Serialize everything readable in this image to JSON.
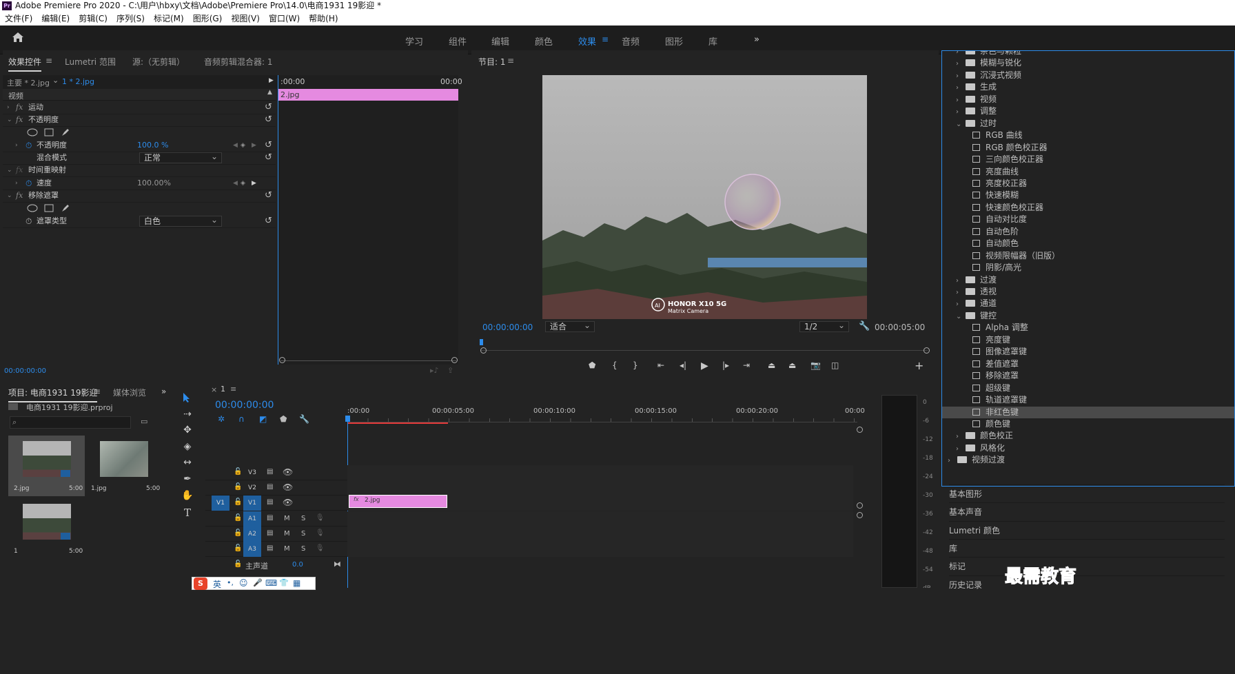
{
  "app": {
    "window_title": "Adobe Premiere Pro 2020 - C:\\用户\\hbxy\\文档\\Adobe\\Premiere Pro\\14.0\\电商1931  19影迎 *",
    "logo": "Pr"
  },
  "menu": [
    "文件(F)",
    "编辑(E)",
    "剪辑(C)",
    "序列(S)",
    "标记(M)",
    "图形(G)",
    "视图(V)",
    "窗口(W)",
    "帮助(H)"
  ],
  "workspaces": {
    "tabs": [
      "学习",
      "组件",
      "编辑",
      "颜色",
      "效果",
      "音频",
      "图形",
      "库"
    ],
    "active": "效果",
    "more": "»",
    "menu_glyph": "≡"
  },
  "effect_controls": {
    "tabs": [
      "效果控件",
      "Lumetri 范围",
      "源:（无剪辑）",
      "音频剪辑混合器: 1"
    ],
    "menu_glyph": "≡",
    "master_label": "主要 * 2.jpg",
    "clip_label": "1 * 2.jpg",
    "time_start": ":00:00",
    "time_end": "00:00",
    "clip_bar_label": "2.jpg",
    "section_video": "视频",
    "rows": [
      {
        "name": "运动",
        "kind": "effect"
      },
      {
        "name": "不透明度",
        "kind": "effect"
      },
      {
        "name": "不透明度",
        "kind": "param",
        "value": "100.0 %"
      },
      {
        "name": "混合模式",
        "kind": "param",
        "value": "正常"
      },
      {
        "name": "时间重映射",
        "kind": "effect"
      },
      {
        "name": "速度",
        "kind": "param",
        "value": "100.00%"
      },
      {
        "name": "移除遮罩",
        "kind": "effect"
      },
      {
        "name": "遮罩类型",
        "kind": "param",
        "value": "白色"
      }
    ],
    "fx_label": "fx",
    "timecode": "00:00:00:00"
  },
  "program_monitor": {
    "title": "节目: 1",
    "menu_glyph": "≡",
    "timecode": "00:00:00:00",
    "zoom": "适合",
    "resolution": "1/2",
    "duration": "00:00:05:00",
    "watermark_brand": "HONOR X10 5G",
    "watermark_sub": "Matrix Camera",
    "watermark_logo": "AI",
    "controls": [
      "marker",
      "in",
      "out",
      "go-to-in",
      "step-back",
      "play",
      "step-forward",
      "go-to-out",
      "lift",
      "extract",
      "export-frame",
      "comparison"
    ],
    "add_glyph": "+"
  },
  "project": {
    "tabs": [
      "项目: 电商1931  19影迎",
      "媒体浏览"
    ],
    "menu_glyph": "≡",
    "more": "»",
    "file": "电商1931  19影迎.prproj",
    "search_placeholder": "",
    "items": [
      {
        "name": "2.jpg",
        "duration": "5:00"
      },
      {
        "name": "1.jpg",
        "duration": "5:00"
      },
      {
        "name": "1",
        "duration": "5:00"
      }
    ]
  },
  "timeline": {
    "tab": "1",
    "close": "×",
    "menu_glyph": "≡",
    "timecode": "00:00:00:00",
    "ruler": [
      ":00:00",
      "00:00:05:00",
      "00:00:10:00",
      "00:00:15:00",
      "00:00:20:00",
      "00:00"
    ],
    "video_tracks": [
      "V3",
      "V2",
      "V1"
    ],
    "source_patch": "V1",
    "audio_tracks": [
      "A1",
      "A2",
      "A3"
    ],
    "mute": "M",
    "solo": "S",
    "master": "主声道",
    "master_value": "0.0",
    "clip_label": "2.jpg",
    "clip_fx": "fx"
  },
  "effects_tree": [
    {
      "label": "杂色与颗粒",
      "type": "folder",
      "level": 1,
      "open": false
    },
    {
      "label": "模糊与锐化",
      "type": "folder",
      "level": 1,
      "open": false
    },
    {
      "label": "沉浸式视频",
      "type": "folder",
      "level": 1,
      "open": false
    },
    {
      "label": "生成",
      "type": "folder",
      "level": 1,
      "open": false
    },
    {
      "label": "视频",
      "type": "folder",
      "level": 1,
      "open": false
    },
    {
      "label": "调整",
      "type": "folder",
      "level": 1,
      "open": false
    },
    {
      "label": "过时",
      "type": "folder",
      "level": 1,
      "open": true
    },
    {
      "label": "RGB 曲线",
      "type": "preset",
      "level": 2
    },
    {
      "label": "RGB 颜色校正器",
      "type": "preset",
      "level": 2
    },
    {
      "label": "三向颜色校正器",
      "type": "preset",
      "level": 2
    },
    {
      "label": "亮度曲线",
      "type": "preset",
      "level": 2
    },
    {
      "label": "亮度校正器",
      "type": "preset",
      "level": 2
    },
    {
      "label": "快速模糊",
      "type": "preset",
      "level": 2
    },
    {
      "label": "快速颜色校正器",
      "type": "preset",
      "level": 2
    },
    {
      "label": "自动对比度",
      "type": "preset",
      "level": 2
    },
    {
      "label": "自动色阶",
      "type": "preset",
      "level": 2
    },
    {
      "label": "自动颜色",
      "type": "preset",
      "level": 2
    },
    {
      "label": "视频限幅器（旧版）",
      "type": "preset",
      "level": 2
    },
    {
      "label": "阴影/高光",
      "type": "preset",
      "level": 2
    },
    {
      "label": "过渡",
      "type": "folder",
      "level": 1,
      "open": false
    },
    {
      "label": "透视",
      "type": "folder",
      "level": 1,
      "open": false
    },
    {
      "label": "通道",
      "type": "folder",
      "level": 1,
      "open": false
    },
    {
      "label": "键控",
      "type": "folder",
      "level": 1,
      "open": true
    },
    {
      "label": "Alpha 调整",
      "type": "preset",
      "level": 2
    },
    {
      "label": "亮度键",
      "type": "preset",
      "level": 2
    },
    {
      "label": "图像遮罩键",
      "type": "preset",
      "level": 2
    },
    {
      "label": "差值遮罩",
      "type": "preset",
      "level": 2
    },
    {
      "label": "移除遮罩",
      "type": "preset",
      "level": 2
    },
    {
      "label": "超级键",
      "type": "preset",
      "level": 2
    },
    {
      "label": "轨道遮罩键",
      "type": "preset",
      "level": 2
    },
    {
      "label": "非红色键",
      "type": "preset",
      "level": 2,
      "selected": true
    },
    {
      "label": "颜色键",
      "type": "preset",
      "level": 2
    },
    {
      "label": "颜色校正",
      "type": "folder",
      "level": 1,
      "open": false
    },
    {
      "label": "风格化",
      "type": "folder",
      "level": 1,
      "open": false
    },
    {
      "label": "视频过渡",
      "type": "folder",
      "level": 0,
      "open": false
    }
  ],
  "side_panels": [
    "基本图形",
    "基本声音",
    "Lumetri 颜色",
    "库",
    "标记",
    "历史记录"
  ],
  "audio_meter": {
    "scale": [
      "0",
      "-6",
      "-12",
      "-18",
      "-24",
      "-30",
      "-36",
      "-42",
      "-48",
      "-54",
      "dB"
    ]
  },
  "ime_bar": {
    "logo": "S",
    "lang": "英",
    "items": [
      "•,",
      "☺",
      "🎤",
      "⌨",
      "👕",
      "▦"
    ]
  },
  "corner_watermark": "最需教育",
  "colors": {
    "accent": "#2d8ceb",
    "clip_pink": "#e58ae0",
    "panel_bg": "#232323",
    "panel_dark": "#1d1d1d",
    "track_blue": "#1f5f9e",
    "playhead_red": "#e53a3a"
  }
}
